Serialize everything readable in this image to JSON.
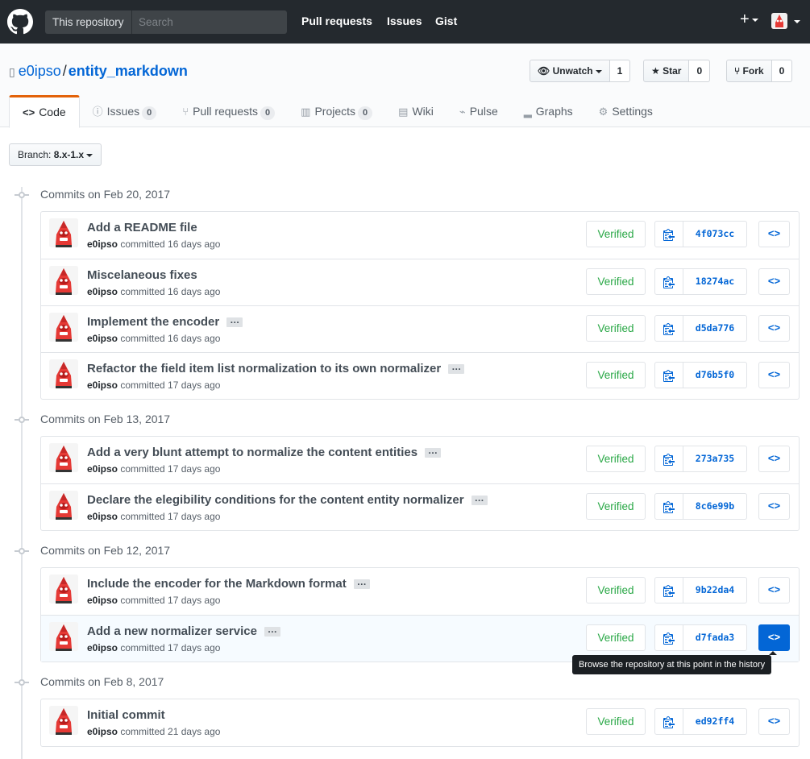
{
  "header": {
    "scope_label": "This repository",
    "search_placeholder": "Search",
    "nav": [
      "Pull requests",
      "Issues",
      "Gist"
    ],
    "new_label": "+"
  },
  "repo": {
    "owner": "e0ipso",
    "separator": "/",
    "name": "entity_markdown",
    "watch_label": "Unwatch",
    "watch_count": "1",
    "star_label": "Star",
    "star_count": "0",
    "fork_label": "Fork",
    "fork_count": "0"
  },
  "tabs": [
    {
      "label": "Code",
      "icon": "<>"
    },
    {
      "label": "Issues",
      "icon": "ⓘ",
      "count": "0"
    },
    {
      "label": "Pull requests",
      "icon": "⑂",
      "count": "0"
    },
    {
      "label": "Projects",
      "icon": "▥",
      "count": "0"
    },
    {
      "label": "Wiki",
      "icon": "▤"
    },
    {
      "label": "Pulse",
      "icon": "⌁"
    },
    {
      "label": "Graphs",
      "icon": "▂"
    },
    {
      "label": "Settings",
      "icon": "⚙"
    }
  ],
  "branch": {
    "prefix": "Branch:",
    "name": "8.x-1.x"
  },
  "groups": [
    {
      "date": "Commits on Feb 20, 2017",
      "commits": [
        {
          "title": "Add a README file",
          "author": "e0ipso",
          "when": "committed 16 days ago",
          "verified": "Verified",
          "sha": "4f073cc",
          "ellipsis": false
        },
        {
          "title": "Miscelaneous fixes",
          "author": "e0ipso",
          "when": "committed 16 days ago",
          "verified": "Verified",
          "sha": "18274ac",
          "ellipsis": false
        },
        {
          "title": "Implement the encoder",
          "author": "e0ipso",
          "when": "committed 16 days ago",
          "verified": "Verified",
          "sha": "d5da776",
          "ellipsis": true
        },
        {
          "title": "Refactor the field item list normalization to its own normalizer",
          "author": "e0ipso",
          "when": "committed 17 days ago",
          "verified": "Verified",
          "sha": "d76b5f0",
          "ellipsis": true
        }
      ]
    },
    {
      "date": "Commits on Feb 13, 2017",
      "commits": [
        {
          "title": "Add a very blunt attempt to normalize the content entities",
          "author": "e0ipso",
          "when": "committed 17 days ago",
          "verified": "Verified",
          "sha": "273a735",
          "ellipsis": true
        },
        {
          "title": "Declare the elegibility conditions for the content entity normalizer",
          "author": "e0ipso",
          "when": "committed 17 days ago",
          "verified": "Verified",
          "sha": "8c6e99b",
          "ellipsis": true
        }
      ]
    },
    {
      "date": "Commits on Feb 12, 2017",
      "commits": [
        {
          "title": "Include the encoder for the Markdown format",
          "author": "e0ipso",
          "when": "committed 17 days ago",
          "verified": "Verified",
          "sha": "9b22da4",
          "ellipsis": true
        },
        {
          "title": "Add a new normalizer service",
          "author": "e0ipso",
          "when": "committed 17 days ago",
          "verified": "Verified",
          "sha": "d7fada3",
          "ellipsis": true,
          "hover": true
        }
      ]
    },
    {
      "date": "Commits on Feb 8, 2017",
      "commits": [
        {
          "title": "Initial commit",
          "author": "e0ipso",
          "when": "committed 21 days ago",
          "verified": "Verified",
          "sha": "ed92ff4",
          "ellipsis": false
        }
      ]
    }
  ],
  "ellipsis_label": "…",
  "browse_label": "<>",
  "tooltip": "Browse the repository at this point in the history",
  "colors": {
    "header_bg": "#24292e",
    "link": "#0366d6",
    "verified": "#28a745",
    "tab_accent": "#e36209"
  }
}
